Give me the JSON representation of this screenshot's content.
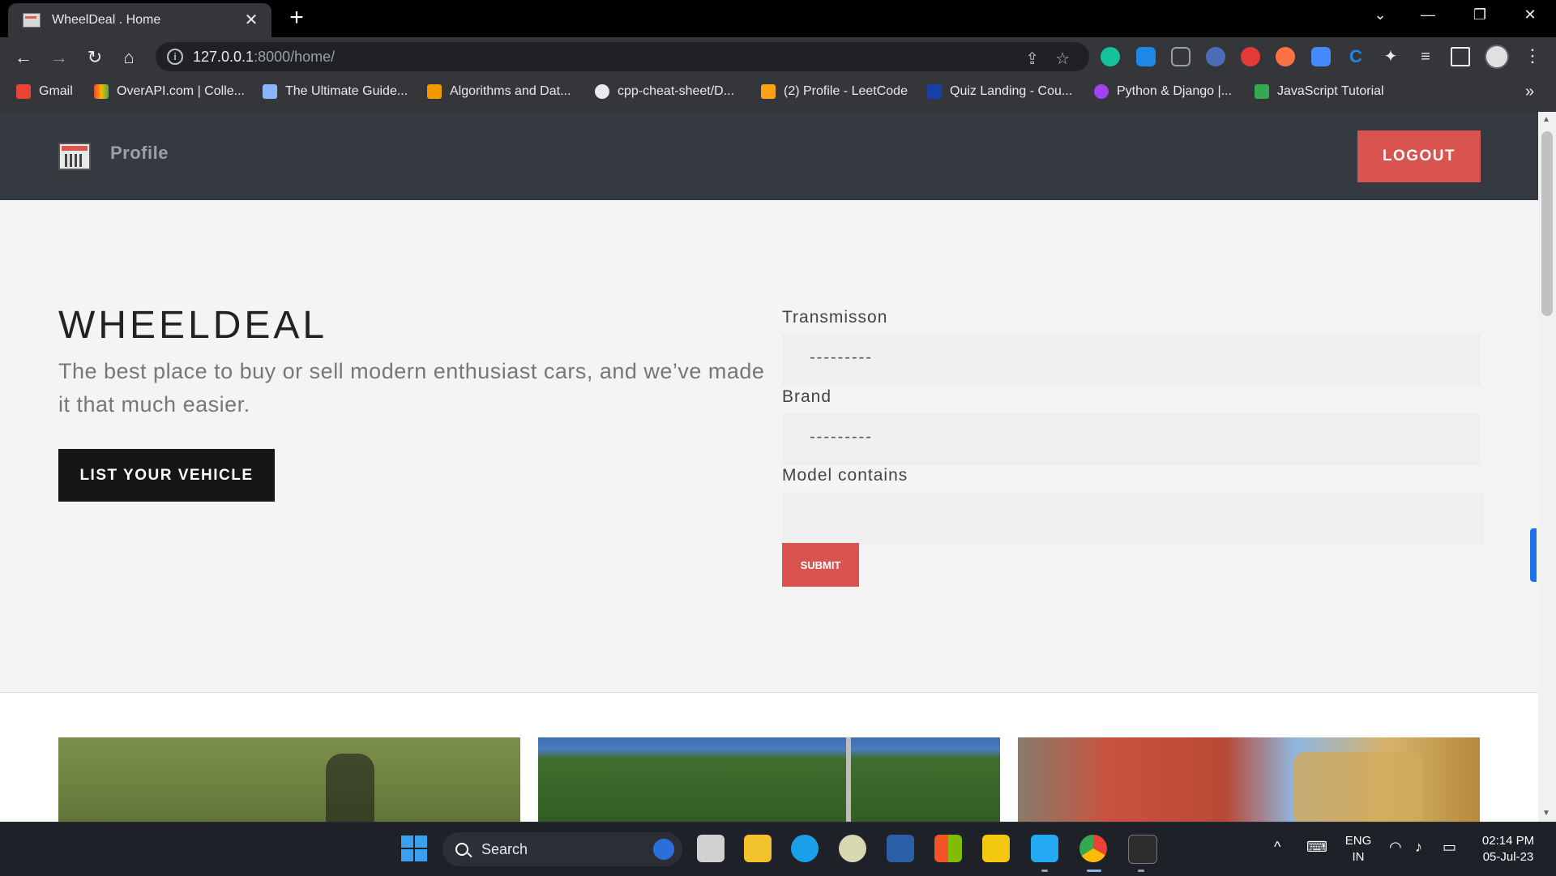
{
  "browser": {
    "tab_title": "WheelDeal . Home",
    "tab_close": "✕",
    "new_tab": "+",
    "url_host": "127.0.0.1",
    "url_rest": ":8000/home/",
    "bookmarks": [
      {
        "label": "Gmail",
        "color": "#ea4335"
      },
      {
        "label": "OverAPI.com | Colle...",
        "color": "#f4b400"
      },
      {
        "label": "The Ultimate Guide...",
        "color": "#8ab4f8"
      },
      {
        "label": "Algorithms and Dat...",
        "color": "#f29900"
      },
      {
        "label": "cpp-cheat-sheet/D...",
        "color": "#e8eaed"
      },
      {
        "label": "(2) Profile - LeetCode",
        "color": "#ffa116"
      },
      {
        "label": "Quiz Landing - Cou...",
        "color": "#1a3ea8"
      },
      {
        "label": "Python & Django |...",
        "color": "#a142f4"
      },
      {
        "label": "JavaScript Tutorial",
        "color": "#34a853"
      }
    ]
  },
  "navbar": {
    "profile_label": "Profile",
    "logout_label": "LOGOUT"
  },
  "hero": {
    "title": "WHEELDEAL",
    "subtitle": "The best place to buy or sell modern enthusiast cars, and we’ve made it that much easier.",
    "cta_label": "LIST YOUR VEHICLE"
  },
  "filter_form": {
    "transmission_label": "Transmisson",
    "transmission_value": "---------",
    "brand_label": "Brand",
    "brand_value": "---------",
    "model_label": "Model contains",
    "model_value": "",
    "submit_label": "SUBMIT"
  },
  "taskbar": {
    "search_label": "Search",
    "lang_top": "ENG",
    "lang_bottom": "IN",
    "time": "02:14 PM",
    "date": "05-Jul-23"
  },
  "colors": {
    "accent_red": "#d9534f",
    "navbar_bg": "#343a40",
    "dark_button": "#161616"
  }
}
